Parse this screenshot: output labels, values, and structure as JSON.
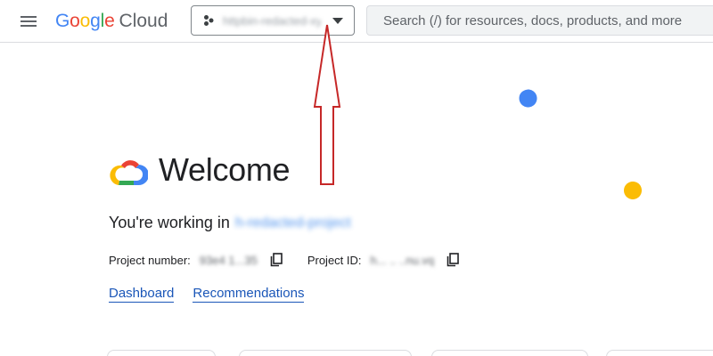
{
  "header": {
    "menu_icon": "hamburger-menu-icon",
    "logo_google": "Google",
    "logo_cloud": "Cloud",
    "project_name": "httpbin-redacted-xyz",
    "search_placeholder": "Search (/) for resources, docs, products, and more"
  },
  "welcome": {
    "title": "Welcome",
    "working_in_label": "You're working in",
    "project_display_name": "h-redacted-project",
    "project_number_label": "Project number:",
    "project_number_value": "93e4   1...35",
    "project_id_label": "Project ID:",
    "project_id_value": "h... .. ..nu.vq"
  },
  "links": {
    "dashboard": "Dashboard",
    "recommendations": "Recommendations"
  },
  "colors": {
    "google_blue": "#4285F4",
    "google_red": "#EA4335",
    "google_yellow": "#FBBC04",
    "google_green": "#34A853",
    "link_blue": "#1a56b8",
    "annotation_red": "#c62828"
  }
}
